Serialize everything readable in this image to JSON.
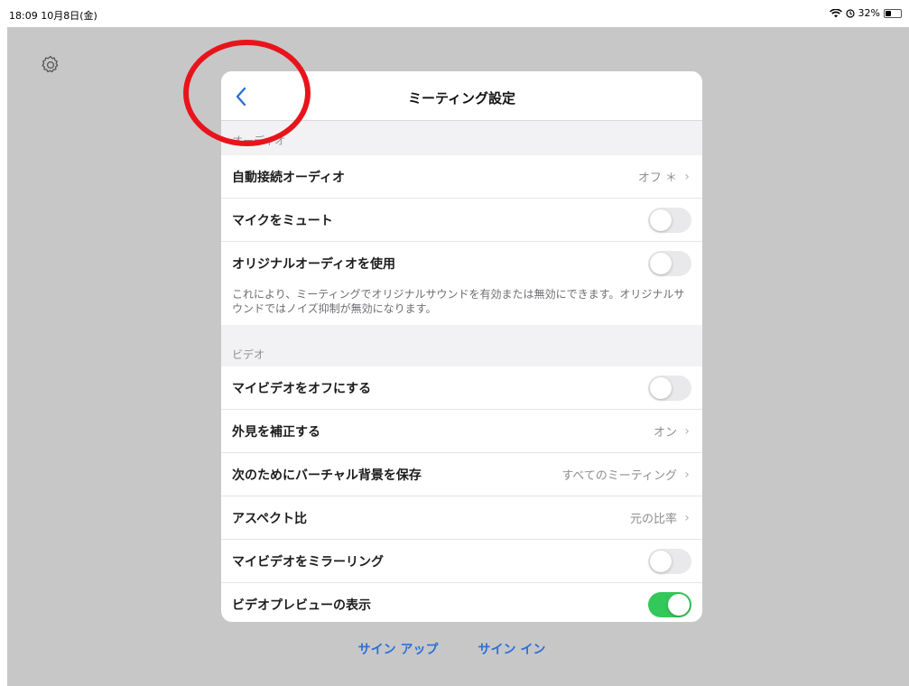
{
  "status": {
    "time_date": "18:09  10月8日(金)",
    "battery": "32%",
    "battery_level": 0.32,
    "wifi_icon": "wifi-icon",
    "alarm_icon": "alarm-icon"
  },
  "modal": {
    "title": "ミーティング設定",
    "back_icon": "chevron-left-icon"
  },
  "audio": {
    "header": "オーディオ",
    "rows": [
      {
        "label": "自動接続オーディオ",
        "value": "オフ ＊",
        "type": "disclosure"
      },
      {
        "label": "マイクをミュート",
        "type": "toggle",
        "on": false
      },
      {
        "label": "オリジナルオーディオを使用",
        "type": "toggle",
        "on": false
      }
    ],
    "description": "これにより、ミーティングでオリジナルサウンドを有効または無効にできます。オリジナルサウンドではノイズ抑制が無効になります。"
  },
  "video": {
    "header": "ビデオ",
    "rows": [
      {
        "label": "マイビデオをオフにする",
        "type": "toggle",
        "on": false
      },
      {
        "label": "外見を補正する",
        "value": "オン",
        "type": "disclosure"
      },
      {
        "label": "次のためにバーチャル背景を保存",
        "value": "すべてのミーティング",
        "type": "disclosure"
      },
      {
        "label": "アスペクト比",
        "value": "元の比率",
        "type": "disclosure"
      },
      {
        "label": "マイビデオをミラーリング",
        "type": "toggle",
        "on": false
      },
      {
        "label": "ビデオプレビューの表示",
        "type": "toggle",
        "on": true
      }
    ]
  },
  "footer": {
    "signup": "サイン アップ",
    "signin": "サイン イン"
  },
  "colors": {
    "accent": "#2d6fd6",
    "toggle_on": "#34c759",
    "annotation": "#e8141b",
    "backdrop": "#c7c7c8"
  }
}
